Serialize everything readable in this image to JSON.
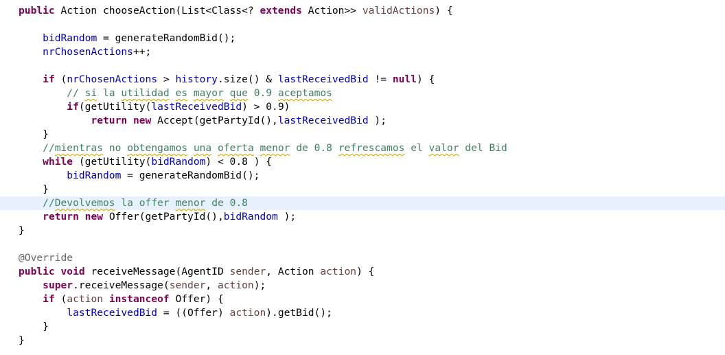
{
  "editor": {
    "highlighted_line": 14,
    "spellcheck_underline_color": "#c8a000",
    "current_line_color": "#e8f2fe",
    "syntax_colors": {
      "keyword": "#7f0055",
      "field": "#0000c0",
      "parameter": "#6a3e3e",
      "comment": "#3f7f5f",
      "annotation": "#646464",
      "plain": "#000000"
    },
    "lines": [
      [
        [
          "kw",
          "public"
        ],
        [
          "plain",
          " Action chooseAction(List<Class<? "
        ],
        [
          "kw",
          "extends"
        ],
        [
          "plain",
          " Action>> "
        ],
        [
          "param",
          "validActions"
        ],
        [
          "plain",
          ") {"
        ]
      ],
      [],
      [
        [
          "plain",
          "    "
        ],
        [
          "field",
          "bidRandom"
        ],
        [
          "plain",
          " = generateRandomBid();"
        ]
      ],
      [
        [
          "plain",
          "    "
        ],
        [
          "field",
          "nrChosenActions"
        ],
        [
          "plain",
          "++;"
        ]
      ],
      [],
      [
        [
          "plain",
          "    "
        ],
        [
          "kw",
          "if"
        ],
        [
          "plain",
          " ("
        ],
        [
          "field",
          "nrChosenActions"
        ],
        [
          "plain",
          " > "
        ],
        [
          "field",
          "history"
        ],
        [
          "plain",
          ".size() & "
        ],
        [
          "field",
          "lastReceivedBid"
        ],
        [
          "plain",
          " != "
        ],
        [
          "kw",
          "null"
        ],
        [
          "plain",
          ") {"
        ]
      ],
      [
        [
          "plain",
          "        "
        ],
        [
          "comment",
          "// "
        ],
        [
          "comment-spell",
          "si"
        ],
        [
          "comment",
          " la "
        ],
        [
          "comment-spell",
          "utilidad"
        ],
        [
          "comment",
          " "
        ],
        [
          "comment-spell",
          "es"
        ],
        [
          "comment",
          " "
        ],
        [
          "comment-spell",
          "mayor"
        ],
        [
          "comment",
          " "
        ],
        [
          "comment-spell",
          "que"
        ],
        [
          "comment",
          " 0.9 "
        ],
        [
          "comment-spell",
          "aceptamos"
        ]
      ],
      [
        [
          "plain",
          "        "
        ],
        [
          "kw",
          "if"
        ],
        [
          "plain",
          "(getUtility("
        ],
        [
          "field",
          "lastReceivedBid"
        ],
        [
          "plain",
          ") > 0.9)"
        ]
      ],
      [
        [
          "plain",
          "            "
        ],
        [
          "kw",
          "return"
        ],
        [
          "plain",
          " "
        ],
        [
          "kw",
          "new"
        ],
        [
          "plain",
          " Accept(getPartyId(),"
        ],
        [
          "field",
          "lastReceivedBid"
        ],
        [
          "plain",
          " );"
        ]
      ],
      [
        [
          "plain",
          "    }"
        ]
      ],
      [
        [
          "plain",
          "    "
        ],
        [
          "comment",
          "//"
        ],
        [
          "comment-spell",
          "mientras"
        ],
        [
          "comment",
          " no "
        ],
        [
          "comment-spell",
          "obtengamos"
        ],
        [
          "comment",
          " "
        ],
        [
          "comment-spell",
          "una"
        ],
        [
          "comment",
          " "
        ],
        [
          "comment-spell",
          "oferta"
        ],
        [
          "comment",
          " "
        ],
        [
          "comment-spell",
          "menor"
        ],
        [
          "comment",
          " de 0.8 "
        ],
        [
          "comment-spell",
          "refrescamos"
        ],
        [
          "comment",
          " el "
        ],
        [
          "comment-spell",
          "valor"
        ],
        [
          "comment",
          " del Bid"
        ]
      ],
      [
        [
          "plain",
          "    "
        ],
        [
          "kw",
          "while"
        ],
        [
          "plain",
          " (getUtility("
        ],
        [
          "field",
          "bidRandom"
        ],
        [
          "plain",
          ") < 0.8 ) {"
        ]
      ],
      [
        [
          "plain",
          "        "
        ],
        [
          "field",
          "bidRandom"
        ],
        [
          "plain",
          " = generateRandomBid();"
        ]
      ],
      [
        [
          "plain",
          "    }"
        ]
      ],
      [
        [
          "plain",
          "    "
        ],
        [
          "comment",
          "//"
        ],
        [
          "comment-spell",
          "Devolvemos"
        ],
        [
          "comment",
          " la offer "
        ],
        [
          "comment-spell",
          "menor"
        ],
        [
          "comment",
          " de 0.8"
        ]
      ],
      [
        [
          "plain",
          "    "
        ],
        [
          "kw",
          "return"
        ],
        [
          "plain",
          " "
        ],
        [
          "kw",
          "new"
        ],
        [
          "plain",
          " Offer(getPartyId(),"
        ],
        [
          "field",
          "bidRandom"
        ],
        [
          "plain",
          " );"
        ]
      ],
      [
        [
          "plain",
          "}"
        ]
      ],
      [],
      [
        [
          "annot",
          "@Override"
        ]
      ],
      [
        [
          "kw",
          "public"
        ],
        [
          "plain",
          " "
        ],
        [
          "kw",
          "void"
        ],
        [
          "plain",
          " receiveMessage(AgentID "
        ],
        [
          "param",
          "sender"
        ],
        [
          "plain",
          ", Action "
        ],
        [
          "param",
          "action"
        ],
        [
          "plain",
          ") {"
        ]
      ],
      [
        [
          "plain",
          "    "
        ],
        [
          "kw",
          "super"
        ],
        [
          "plain",
          ".receiveMessage("
        ],
        [
          "param",
          "sender"
        ],
        [
          "plain",
          ", "
        ],
        [
          "param",
          "action"
        ],
        [
          "plain",
          ");"
        ]
      ],
      [
        [
          "plain",
          "    "
        ],
        [
          "kw",
          "if"
        ],
        [
          "plain",
          " ("
        ],
        [
          "param",
          "action"
        ],
        [
          "plain",
          " "
        ],
        [
          "kw",
          "instanceof"
        ],
        [
          "plain",
          " Offer) {"
        ]
      ],
      [
        [
          "plain",
          "        "
        ],
        [
          "field",
          "lastReceivedBid"
        ],
        [
          "plain",
          " = ((Offer) "
        ],
        [
          "param",
          "action"
        ],
        [
          "plain",
          ").getBid();"
        ]
      ],
      [
        [
          "plain",
          "    }"
        ]
      ],
      [
        [
          "plain",
          "}"
        ]
      ]
    ]
  }
}
